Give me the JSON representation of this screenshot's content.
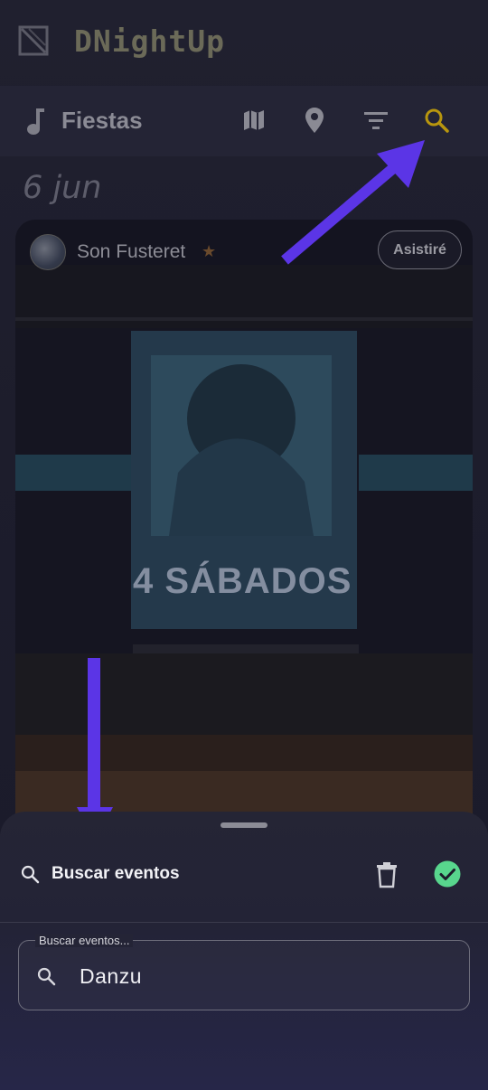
{
  "app": {
    "title": "DNightUp"
  },
  "toolbar": {
    "section_title": "Fiestas",
    "icons": [
      "music-note-icon",
      "map-icon",
      "location-pin-icon",
      "filter-icon",
      "search-icon"
    ]
  },
  "feed": {
    "date_label": "6 jun",
    "card": {
      "organizer": "Son Fusteret",
      "attend_button": "Asistiré",
      "promo_text": "4 SÁBADOS"
    }
  },
  "search_sheet": {
    "title": "Buscar eventos",
    "field_label": "Buscar eventos...",
    "field_value": "Danzu"
  },
  "colors": {
    "accent_search": "#b8960e",
    "confirm_green": "#58d68d",
    "annotation_arrow": "#5b35e6"
  }
}
